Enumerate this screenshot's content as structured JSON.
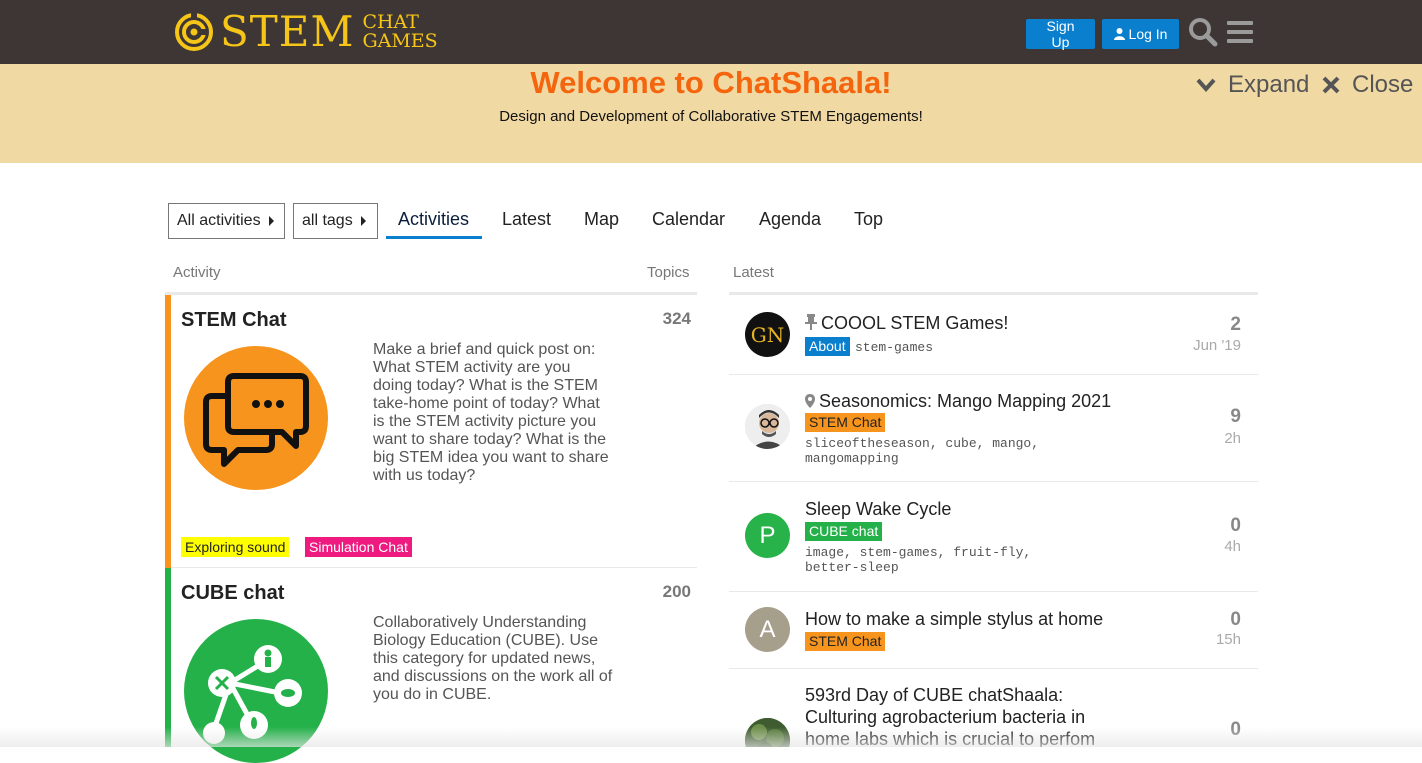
{
  "header": {
    "logo_main": "STEM",
    "logo_sub1": "CHAT",
    "logo_sub2": "GAMES",
    "signup_label": "Sign Up",
    "login_label": "Log In",
    "search_icon": "search-icon",
    "menu_icon": "hamburger-icon",
    "bg_color": "#3d3635",
    "accent_color": "#f5c518",
    "button_color": "#0a7fce"
  },
  "banner": {
    "title": "Welcome to ChatShaala!",
    "subtitle": "Design and Development of Collaborative STEM Engagements!",
    "expand_label": "Expand",
    "close_label": "Close",
    "bg_color": "#f1d9a4",
    "title_color": "#f4650e"
  },
  "nav": {
    "activities_dropdown": "All activities",
    "tags_dropdown": "all tags",
    "tabs": [
      "Activities",
      "Latest",
      "Map",
      "Calendar",
      "Agenda",
      "Top"
    ],
    "active_tab": "Activities"
  },
  "columns": {
    "activity": "Activity",
    "topics": "Topics",
    "latest": "Latest"
  },
  "categories": [
    {
      "name": "STEM Chat",
      "topics": "324",
      "color": "#f7941d",
      "description": "Make a brief and quick post on: What STEM activity are you doing today? What is the STEM take-home point of today? What is the STEM activity picture you want to share today? What is the big STEM idea you want to share with us today?",
      "subcategories": [
        {
          "label": "Exploring sound",
          "bg": "#ffff00",
          "fg": "#222"
        },
        {
          "label": "Simulation Chat",
          "bg": "#ee1a7f",
          "fg": "#fff"
        }
      ]
    },
    {
      "name": "CUBE chat",
      "topics": "200",
      "color": "#25b14a",
      "description": "Collaboratively Understanding Biology Education (CUBE). Use this category for updated news, and discussions on the work all of you do in CUBE."
    }
  ],
  "latest": [
    {
      "title": "COOOL STEM Games!",
      "icon": "pin-icon",
      "category": "About",
      "category_color": "#0a7fce",
      "tags": "stem-games",
      "replies": "2",
      "age": "Jun '19",
      "avatar_text": "GN"
    },
    {
      "title": "Seasonomics: Mango Mapping 2021",
      "icon": "location-icon",
      "category": "STEM Chat",
      "category_color": "#f7941d",
      "tags": "sliceoftheseason, cube, mango, mangomapping",
      "tags_line1": "sliceoftheseason, cube, mango,",
      "tags_line2": "mangomapping",
      "replies": "9",
      "age": "2h"
    },
    {
      "title": "Sleep Wake Cycle",
      "category": "CUBE chat",
      "category_color": "#25b14a",
      "tags": "image, stem-games, fruit-fly, better-sleep",
      "tags_line1": "image, stem-games, fruit-fly,",
      "tags_line2": "better-sleep",
      "replies": "0",
      "age": "4h",
      "avatar_text": "P"
    },
    {
      "title": "How to make a simple stylus at home",
      "category": "STEM Chat",
      "category_color": "#f7941d",
      "replies": "0",
      "age": "15h",
      "avatar_text": "A"
    },
    {
      "title": "593rd Day of CUBE chatShaala: Culturing agrobacterium bacteria in home labs which is crucial to perfom",
      "replies": "0"
    }
  ]
}
